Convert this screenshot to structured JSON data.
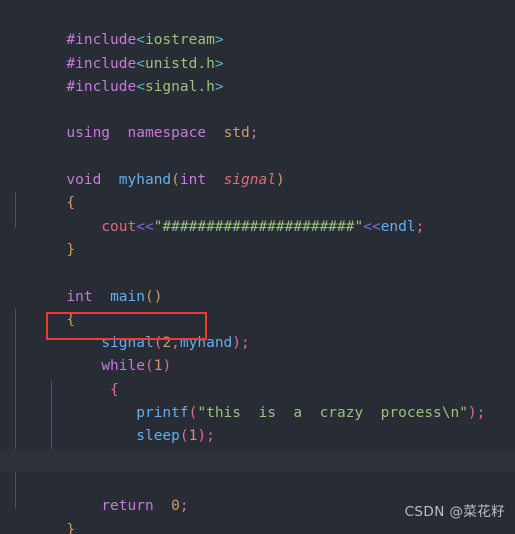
{
  "editor": {
    "background": "#282c34",
    "active_line_background": "#2c313a",
    "indent_guide_color": "#4b5263",
    "annotation_color": "#ef3b2d",
    "language": "cpp"
  },
  "code": {
    "lines": [
      {
        "id": "l1",
        "text": "#include<iostream>"
      },
      {
        "id": "l2",
        "text": "#include<unistd.h>"
      },
      {
        "id": "l3",
        "text": "#include<signal.h>"
      },
      {
        "id": "l4",
        "text": ""
      },
      {
        "id": "l5",
        "text": "using  namespace  std;"
      },
      {
        "id": "l6",
        "text": ""
      },
      {
        "id": "l7",
        "text": "void  myhand(int  signal)"
      },
      {
        "id": "l8",
        "text": "{"
      },
      {
        "id": "l9",
        "text": "    cout<<\"######################\"<<endl;"
      },
      {
        "id": "l10",
        "text": "}"
      },
      {
        "id": "l11",
        "text": ""
      },
      {
        "id": "l12",
        "text": "int  main()"
      },
      {
        "id": "l13",
        "text": "{"
      },
      {
        "id": "l14",
        "text": "    signal(2,myhand);"
      },
      {
        "id": "l15",
        "text": "    while(1)"
      },
      {
        "id": "l16",
        "text": "     {"
      },
      {
        "id": "l17",
        "text": "        printf(\"this  is  a  crazy  process\\n\");"
      },
      {
        "id": "l18",
        "text": "        sleep(1);"
      },
      {
        "id": "l19",
        "text": "     }"
      },
      {
        "id": "l20",
        "text": ""
      },
      {
        "id": "l21",
        "text": "    return  0;"
      },
      {
        "id": "l22",
        "text": "}"
      }
    ],
    "tokens": {
      "include_directive": "#include",
      "angle_open": "<",
      "angle_close": ">",
      "header_iostream": "iostream",
      "header_unistd": "unistd.h",
      "header_signal": "signal.h",
      "kw_using": "using",
      "kw_namespace": "namespace",
      "id_std": "std",
      "semicolon": ";",
      "kw_void": "void",
      "fn_myhand": "myhand",
      "kw_int": "int",
      "param_signal": "signal",
      "brace_open": "{",
      "brace_close": "}",
      "paren_open": "(",
      "paren_close": ")",
      "obj_cout": "cout",
      "op_shift_left": "<<",
      "str_hashes": "\"######################\"",
      "id_endl": "endl",
      "fn_main": "main",
      "call_signal": "signal",
      "num_2": "2",
      "comma": ",",
      "arg_myhand": "myhand",
      "kw_while": "while",
      "num_1": "1",
      "fn_printf": "printf",
      "str_process": "\"this  is  a  crazy  process\\n\"",
      "fn_sleep": "sleep",
      "kw_return": "return",
      "num_0": "0"
    }
  },
  "annotation": {
    "name": "signal-call-highlight",
    "target_text": "signal(2,myhand);",
    "color": "#ef3b2d"
  },
  "watermark": {
    "text": "CSDN @菜花籽"
  }
}
